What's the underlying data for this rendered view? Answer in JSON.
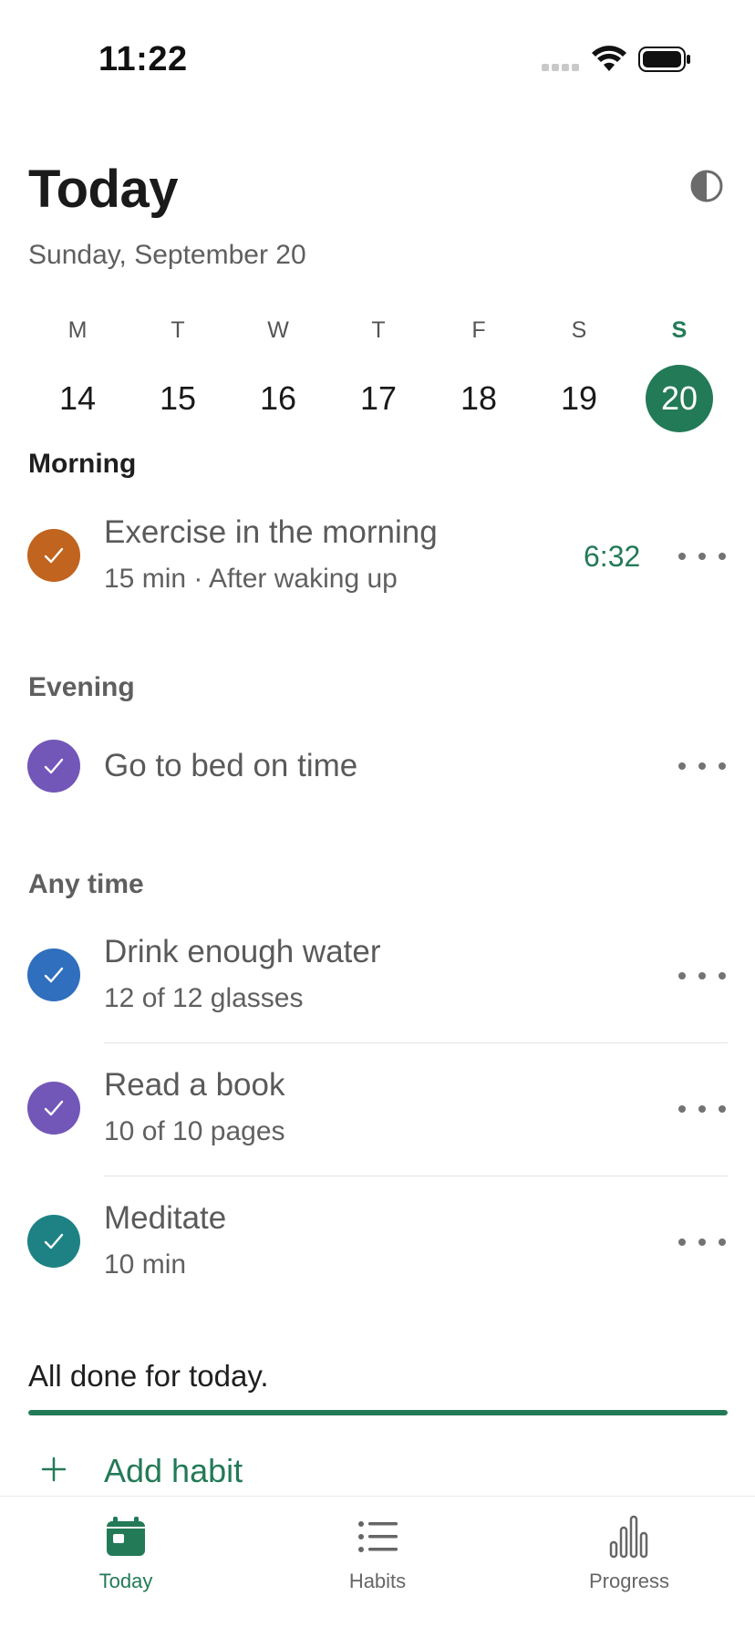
{
  "status_bar": {
    "time": "11:22"
  },
  "header": {
    "title": "Today",
    "date": "Sunday, September 20"
  },
  "week": [
    {
      "letter": "M",
      "num": "14",
      "selected": false
    },
    {
      "letter": "T",
      "num": "15",
      "selected": false
    },
    {
      "letter": "W",
      "num": "16",
      "selected": false
    },
    {
      "letter": "T",
      "num": "17",
      "selected": false
    },
    {
      "letter": "F",
      "num": "18",
      "selected": false
    },
    {
      "letter": "S",
      "num": "19",
      "selected": false
    },
    {
      "letter": "S",
      "num": "20",
      "selected": true
    }
  ],
  "sections": {
    "morning": {
      "title": "Morning",
      "habits": [
        {
          "name": "Exercise in the morning",
          "sub": "15 min · After waking up",
          "timer": "6:32",
          "color": "#c0641f"
        }
      ]
    },
    "evening": {
      "title": "Evening",
      "habits": [
        {
          "name": "Go to bed on time",
          "color": "#7257b8"
        }
      ]
    },
    "anytime": {
      "title": "Any time",
      "habits": [
        {
          "name": "Drink enough water",
          "sub": "12 of 12 glasses",
          "color": "#2f6fbd"
        },
        {
          "name": "Read a book",
          "sub": "10 of 10 pages",
          "color": "#7257b8"
        },
        {
          "name": "Meditate",
          "sub": "10 min",
          "color": "#1e8284"
        }
      ]
    }
  },
  "summary": {
    "text": "All done for today.",
    "progress_percent": 100
  },
  "add_habit": {
    "label": "Add habit"
  },
  "nav": {
    "items": [
      {
        "label": "Today",
        "icon": "calendar-icon",
        "active": true
      },
      {
        "label": "Habits",
        "icon": "list-icon",
        "active": false
      },
      {
        "label": "Progress",
        "icon": "bar-chart-icon",
        "active": false
      }
    ]
  },
  "colors": {
    "accent": "#237a57"
  }
}
